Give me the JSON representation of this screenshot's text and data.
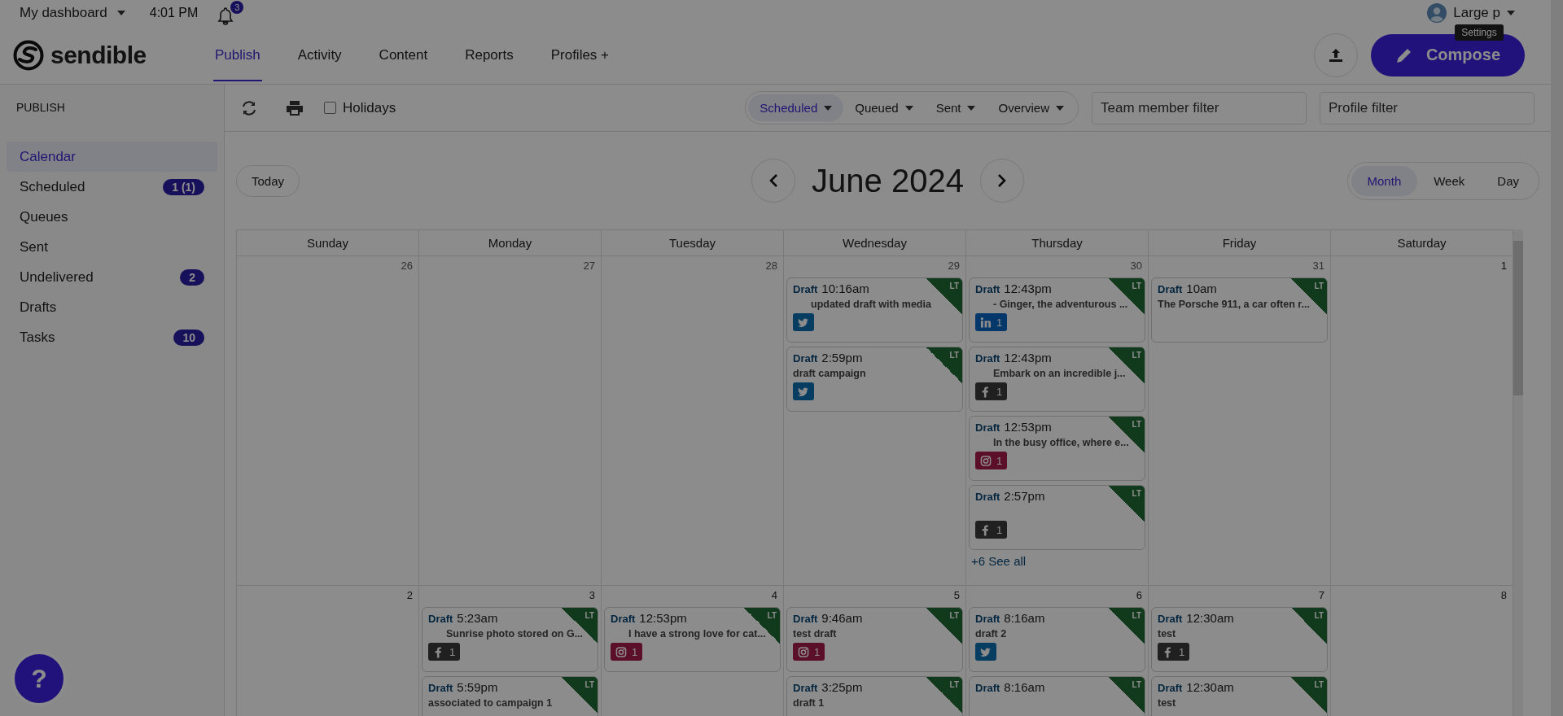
{
  "top_bar": {
    "dashboard": "My dashboard",
    "time": "4:01 PM",
    "notification_count": "3",
    "user": "Large p",
    "tooltip": "Settings"
  },
  "header": {
    "logo": "sendible",
    "tabs": [
      {
        "label": "Publish",
        "selected": true
      },
      {
        "label": "Activity",
        "selected": false
      },
      {
        "label": "Content",
        "selected": false
      },
      {
        "label": "Reports",
        "selected": false
      },
      {
        "label": "Profiles +",
        "selected": false
      }
    ],
    "compose": "Compose"
  },
  "sidebar": {
    "heading": "PUBLISH",
    "items": [
      {
        "label": "Calendar",
        "selected": true
      },
      {
        "label": "Scheduled",
        "badge": "1 (1)",
        "selected": false
      },
      {
        "label": "Queues",
        "selected": false
      },
      {
        "label": "Sent",
        "selected": false
      },
      {
        "label": "Undelivered",
        "badge": "2",
        "selected": false
      },
      {
        "label": "Drafts",
        "selected": false
      },
      {
        "label": "Tasks",
        "badge": "10",
        "selected": false
      }
    ]
  },
  "toolbar": {
    "holidays": {
      "label": "Holidays",
      "checked": false
    },
    "filters": [
      {
        "label": "Scheduled",
        "selected": true
      },
      {
        "label": "Queued",
        "selected": false
      },
      {
        "label": "Sent",
        "selected": false
      },
      {
        "label": "Overview",
        "selected": false
      }
    ],
    "team_filter": {
      "placeholder": "Team member filter"
    },
    "profile_filter": {
      "placeholder": "Profile filter"
    }
  },
  "calendar": {
    "today": "Today",
    "title": "June 2024",
    "views": [
      {
        "label": "Month",
        "selected": true
      },
      {
        "label": "Week",
        "selected": false
      },
      {
        "label": "Day",
        "selected": false
      }
    ],
    "weekdays": [
      "Sunday",
      "Monday",
      "Tuesday",
      "Wednesday",
      "Thursday",
      "Friday",
      "Saturday"
    ],
    "weeks": [
      {
        "days": [
          {
            "date": "26",
            "muted": true
          },
          {
            "date": "27",
            "muted": true
          },
          {
            "date": "28",
            "muted": true
          },
          {
            "date": "29",
            "muted": true,
            "events": [
              {
                "status": "Draft",
                "time": "10:16am",
                "text": "updated draft with media",
                "indent": true,
                "kind": "twitter",
                "tag": "LT"
              },
              {
                "status": "Draft",
                "time": "2:59pm",
                "text": "draft campaign",
                "indent": false,
                "kind": "twitter",
                "tag": "LT"
              }
            ]
          },
          {
            "date": "30",
            "muted": true,
            "more": "+6 See all",
            "events": [
              {
                "status": "Draft",
                "time": "12:43pm",
                "text": "- Ginger, the adventurous ...",
                "indent": true,
                "kind": "linkedin",
                "count": "1",
                "tag": "LT"
              },
              {
                "status": "Draft",
                "time": "12:43pm",
                "text": "Embark on an incredible j...",
                "indent": true,
                "kind": "facebook",
                "count": "1",
                "tag": "LT"
              },
              {
                "status": "Draft",
                "time": "12:53pm",
                "text": "In the busy office, where e...",
                "indent": true,
                "kind": "instagram",
                "count": "1",
                "tag": "LT"
              },
              {
                "status": "Draft",
                "time": "2:57pm",
                "kind": "facebook",
                "count": "1",
                "tag": "LT"
              }
            ]
          },
          {
            "date": "31",
            "muted": true,
            "events": [
              {
                "status": "Draft",
                "time": "10am",
                "text": "The Porsche 911, a car often r...",
                "indent": false,
                "tag": "LT"
              }
            ]
          },
          {
            "date": "1",
            "muted": false
          }
        ]
      },
      {
        "days": [
          {
            "date": "2",
            "muted": false
          },
          {
            "date": "3",
            "muted": false,
            "events": [
              {
                "status": "Draft",
                "time": "5:23am",
                "text": "Sunrise photo stored on G...",
                "indent": true,
                "kind": "facebook",
                "count": "1",
                "tag": "LT"
              },
              {
                "status": "Draft",
                "time": "5:59pm",
                "text": "associated to campaign 1",
                "indent": false,
                "tag": "LT"
              }
            ]
          },
          {
            "date": "4",
            "muted": false,
            "events": [
              {
                "status": "Draft",
                "time": "12:53pm",
                "text": "I have a strong love for cat...",
                "indent": true,
                "kind": "instagram",
                "count": "1",
                "tag": "LT"
              }
            ]
          },
          {
            "date": "5",
            "muted": false,
            "events": [
              {
                "status": "Draft",
                "time": "9:46am",
                "text": "test draft",
                "indent": false,
                "kind": "instagram",
                "count": "1",
                "tag": "LT"
              },
              {
                "status": "Draft",
                "time": "3:25pm",
                "text": "draft 1",
                "indent": false,
                "tag": "LT"
              }
            ]
          },
          {
            "date": "6",
            "muted": false,
            "events": [
              {
                "status": "Draft",
                "time": "8:16am",
                "text": "draft 2",
                "indent": false,
                "kind": "twitter",
                "tag": "LT"
              },
              {
                "status": "Draft",
                "time": "8:16am",
                "tag": "LT"
              }
            ]
          },
          {
            "date": "7",
            "muted": false,
            "events": [
              {
                "status": "Draft",
                "time": "12:30am",
                "text": "test",
                "indent": false,
                "kind": "facebook",
                "count": "1",
                "tag": "LT"
              },
              {
                "status": "Draft",
                "time": "12:30am",
                "text": "test",
                "indent": false,
                "tag": "LT"
              }
            ]
          },
          {
            "date": "8",
            "muted": false
          }
        ]
      }
    ]
  },
  "help": {
    "icon": "?"
  }
}
